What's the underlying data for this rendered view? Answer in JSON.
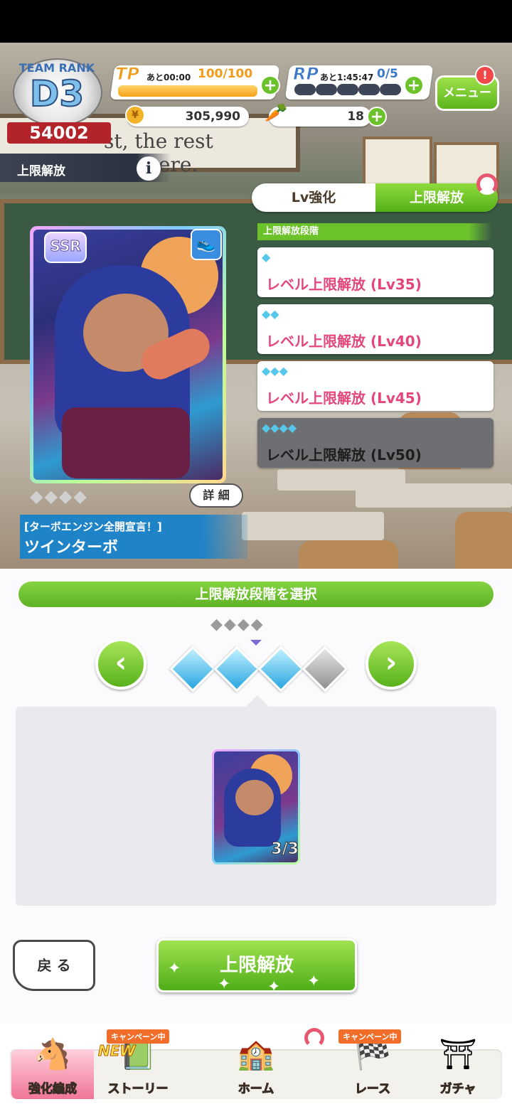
{
  "header": {
    "team_rank_title": "TEAM RANK",
    "team_rank_grade": "D3",
    "team_rank_score": "54002",
    "tp": {
      "label": "TP",
      "timer": "あと00:00",
      "value": "100/100",
      "fill": 1.0
    },
    "rp": {
      "label": "RP",
      "timer": "あと1:45:47",
      "value": "0/5",
      "filled": 0,
      "total": 5
    },
    "coins": "305,990",
    "carrots": "18",
    "menu_label": "メニュー",
    "menu_alert": "!"
  },
  "scene": {
    "board_text": "st, the rest nowhere."
  },
  "page": {
    "title": "上限解放",
    "info": "i"
  },
  "tabs": {
    "lv": "Lv強化",
    "limit_break": "上限解放",
    "active": "limit_break"
  },
  "stages": {
    "header": "上限解放段階",
    "items": [
      {
        "gems": "◆",
        "label": "レベル上限解放 (Lv35)",
        "done": true
      },
      {
        "gems": "◆◆",
        "label": "レベル上限解放 (Lv40)",
        "done": true
      },
      {
        "gems": "◆◆◆",
        "label": "レベル上限解放 (Lv45)",
        "done": true
      },
      {
        "gems": "◆◆◆◆",
        "label": "レベル上限解放 (Lv50)",
        "done": false
      }
    ]
  },
  "card": {
    "rarity": "SSR",
    "gems": "◆◆◆◆",
    "details_label": "詳 細",
    "epithet": "[ターボエンジン全開宣言！]",
    "name": "ツインターボ"
  },
  "select": {
    "title": "上限解放段階を選択",
    "mini_gems": "◆◆◆◆",
    "prev": "‹",
    "next": "›",
    "level": 3,
    "max": 4
  },
  "material": {
    "count": "3/3"
  },
  "actions": {
    "back": "戻 る",
    "unlock": "上限解放"
  },
  "nav": {
    "campaign_label": "キャンペーン中",
    "new_label": "NEW",
    "items": [
      {
        "label": "強化編成"
      },
      {
        "label": "ストーリー"
      },
      {
        "label": "ホーム"
      },
      {
        "label": "レース"
      },
      {
        "label": "ガチャ"
      }
    ]
  },
  "colors": {
    "accent_green": "#6cc22b",
    "pink": "#e3467a",
    "tp_orange": "#f29b1a",
    "rp_blue": "#3b78c8"
  }
}
